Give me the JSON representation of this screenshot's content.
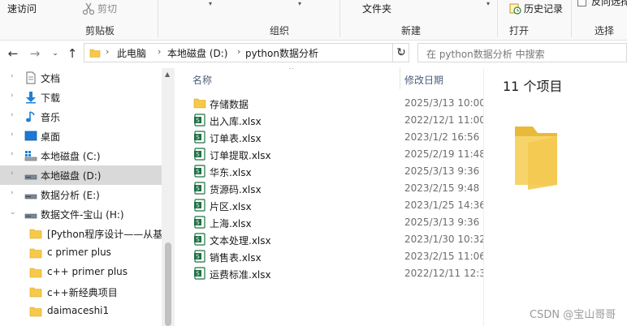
{
  "ribbon": {
    "quick_access": "速访问",
    "cut": "剪切",
    "clipboard": "剪贴板",
    "organize": "组织",
    "new_group": "新建",
    "new_folder": "文件夹",
    "open_group": "打开",
    "history": "历史记录",
    "select_group": "选择",
    "invert_selection": "反向选择"
  },
  "address": {
    "breadcrumbs": [
      "此电脑",
      "本地磁盘 (D:)",
      "python数据分析"
    ],
    "search_placeholder": "在 python数据分析 中搜索"
  },
  "navigation": {
    "items": [
      {
        "label": "文档",
        "icon": "document-icon",
        "pinned": true
      },
      {
        "label": "下载",
        "icon": "download-icon",
        "pinned": true
      },
      {
        "label": "音乐",
        "icon": "music-icon",
        "pinned": true
      },
      {
        "label": "桌面",
        "icon": "desktop-icon",
        "pinned": false
      },
      {
        "label": "本地磁盘 (C:)",
        "icon": "drive-c-icon",
        "pinned": false
      },
      {
        "label": "本地磁盘 (D:)",
        "icon": "drive-icon",
        "selected": true
      },
      {
        "label": "数据分析 (E:)",
        "icon": "drive-icon",
        "pinned": false
      },
      {
        "label": "数据文件-宝山 (H:)",
        "icon": "drive-icon",
        "expanded": true
      },
      {
        "label": "[Python程序设计——从基",
        "icon": "folder-icon"
      },
      {
        "label": "c primer plus",
        "icon": "folder-icon"
      },
      {
        "label": "c++ primer plus",
        "icon": "folder-icon"
      },
      {
        "label": "c++新经典项目",
        "icon": "folder-icon"
      },
      {
        "label": "daimaceshi1",
        "icon": "folder-icon"
      }
    ]
  },
  "file_list": {
    "columns": {
      "name": "名称",
      "modified": "修改日期"
    },
    "files": [
      {
        "name": "存储数据",
        "modified": "2025/3/13 10:00",
        "type": "folder"
      },
      {
        "name": "出入库.xlsx",
        "modified": "2022/12/1 11:00",
        "type": "xlsx"
      },
      {
        "name": "订单表.xlsx",
        "modified": "2023/1/2 16:56",
        "type": "xlsx"
      },
      {
        "name": "订单提取.xlsx",
        "modified": "2025/2/19 11:48",
        "type": "xlsx"
      },
      {
        "name": "华东.xlsx",
        "modified": "2025/3/13 9:36",
        "type": "xlsx"
      },
      {
        "name": "货源码.xlsx",
        "modified": "2023/2/15 9:48",
        "type": "xlsx"
      },
      {
        "name": "片区.xlsx",
        "modified": "2023/1/25 14:36",
        "type": "xlsx"
      },
      {
        "name": "上海.xlsx",
        "modified": "2025/3/13 9:36",
        "type": "xlsx"
      },
      {
        "name": "文本处理.xlsx",
        "modified": "2023/1/30 10:32",
        "type": "xlsx"
      },
      {
        "name": "销售表.xlsx",
        "modified": "2023/2/15 11:06",
        "type": "xlsx"
      },
      {
        "name": "运费标准.xlsx",
        "modified": "2022/12/11 12:3",
        "type": "xlsx"
      }
    ]
  },
  "preview": {
    "item_count": "11 个项目"
  },
  "watermark": "CSDN @宝山哥哥",
  "colors": {
    "folder": "#f7c948",
    "excel": "#1e7145",
    "selected": "#d9d9d9",
    "download_arrow": "#1f7fd6"
  }
}
